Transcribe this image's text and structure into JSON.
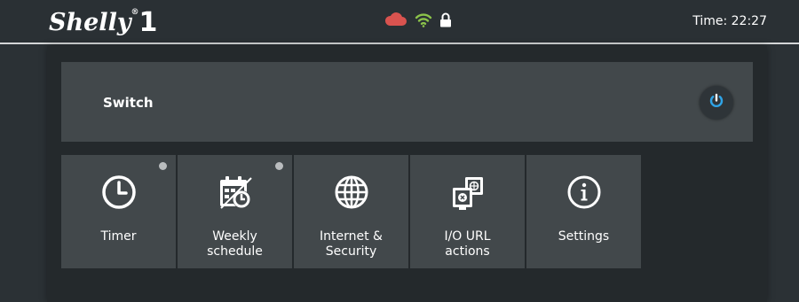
{
  "header": {
    "logo_text": "Shelly",
    "logo_reg": "®",
    "logo_number": "1",
    "time": "Time: 22:27",
    "status_icons": [
      "cloud-icon",
      "wifi-icon",
      "lock-icon"
    ],
    "colors": {
      "cloud": "#d9534f",
      "wifi": "#8bc34a",
      "lock": "#ffffff",
      "power": "#2fa4e7"
    }
  },
  "switch": {
    "label": "Switch"
  },
  "tiles": [
    {
      "label": "Timer",
      "icon": "clock-icon",
      "indicator": true
    },
    {
      "label": "Weekly\nschedule",
      "icon": "weekly-schedule-icon",
      "indicator": true
    },
    {
      "label": "Internet &\nSecurity",
      "icon": "globe-icon",
      "indicator": false
    },
    {
      "label": "I/O URL\nactions",
      "icon": "io-url-actions-icon",
      "indicator": false
    },
    {
      "label": "Settings",
      "icon": "info-icon",
      "indicator": false
    }
  ]
}
